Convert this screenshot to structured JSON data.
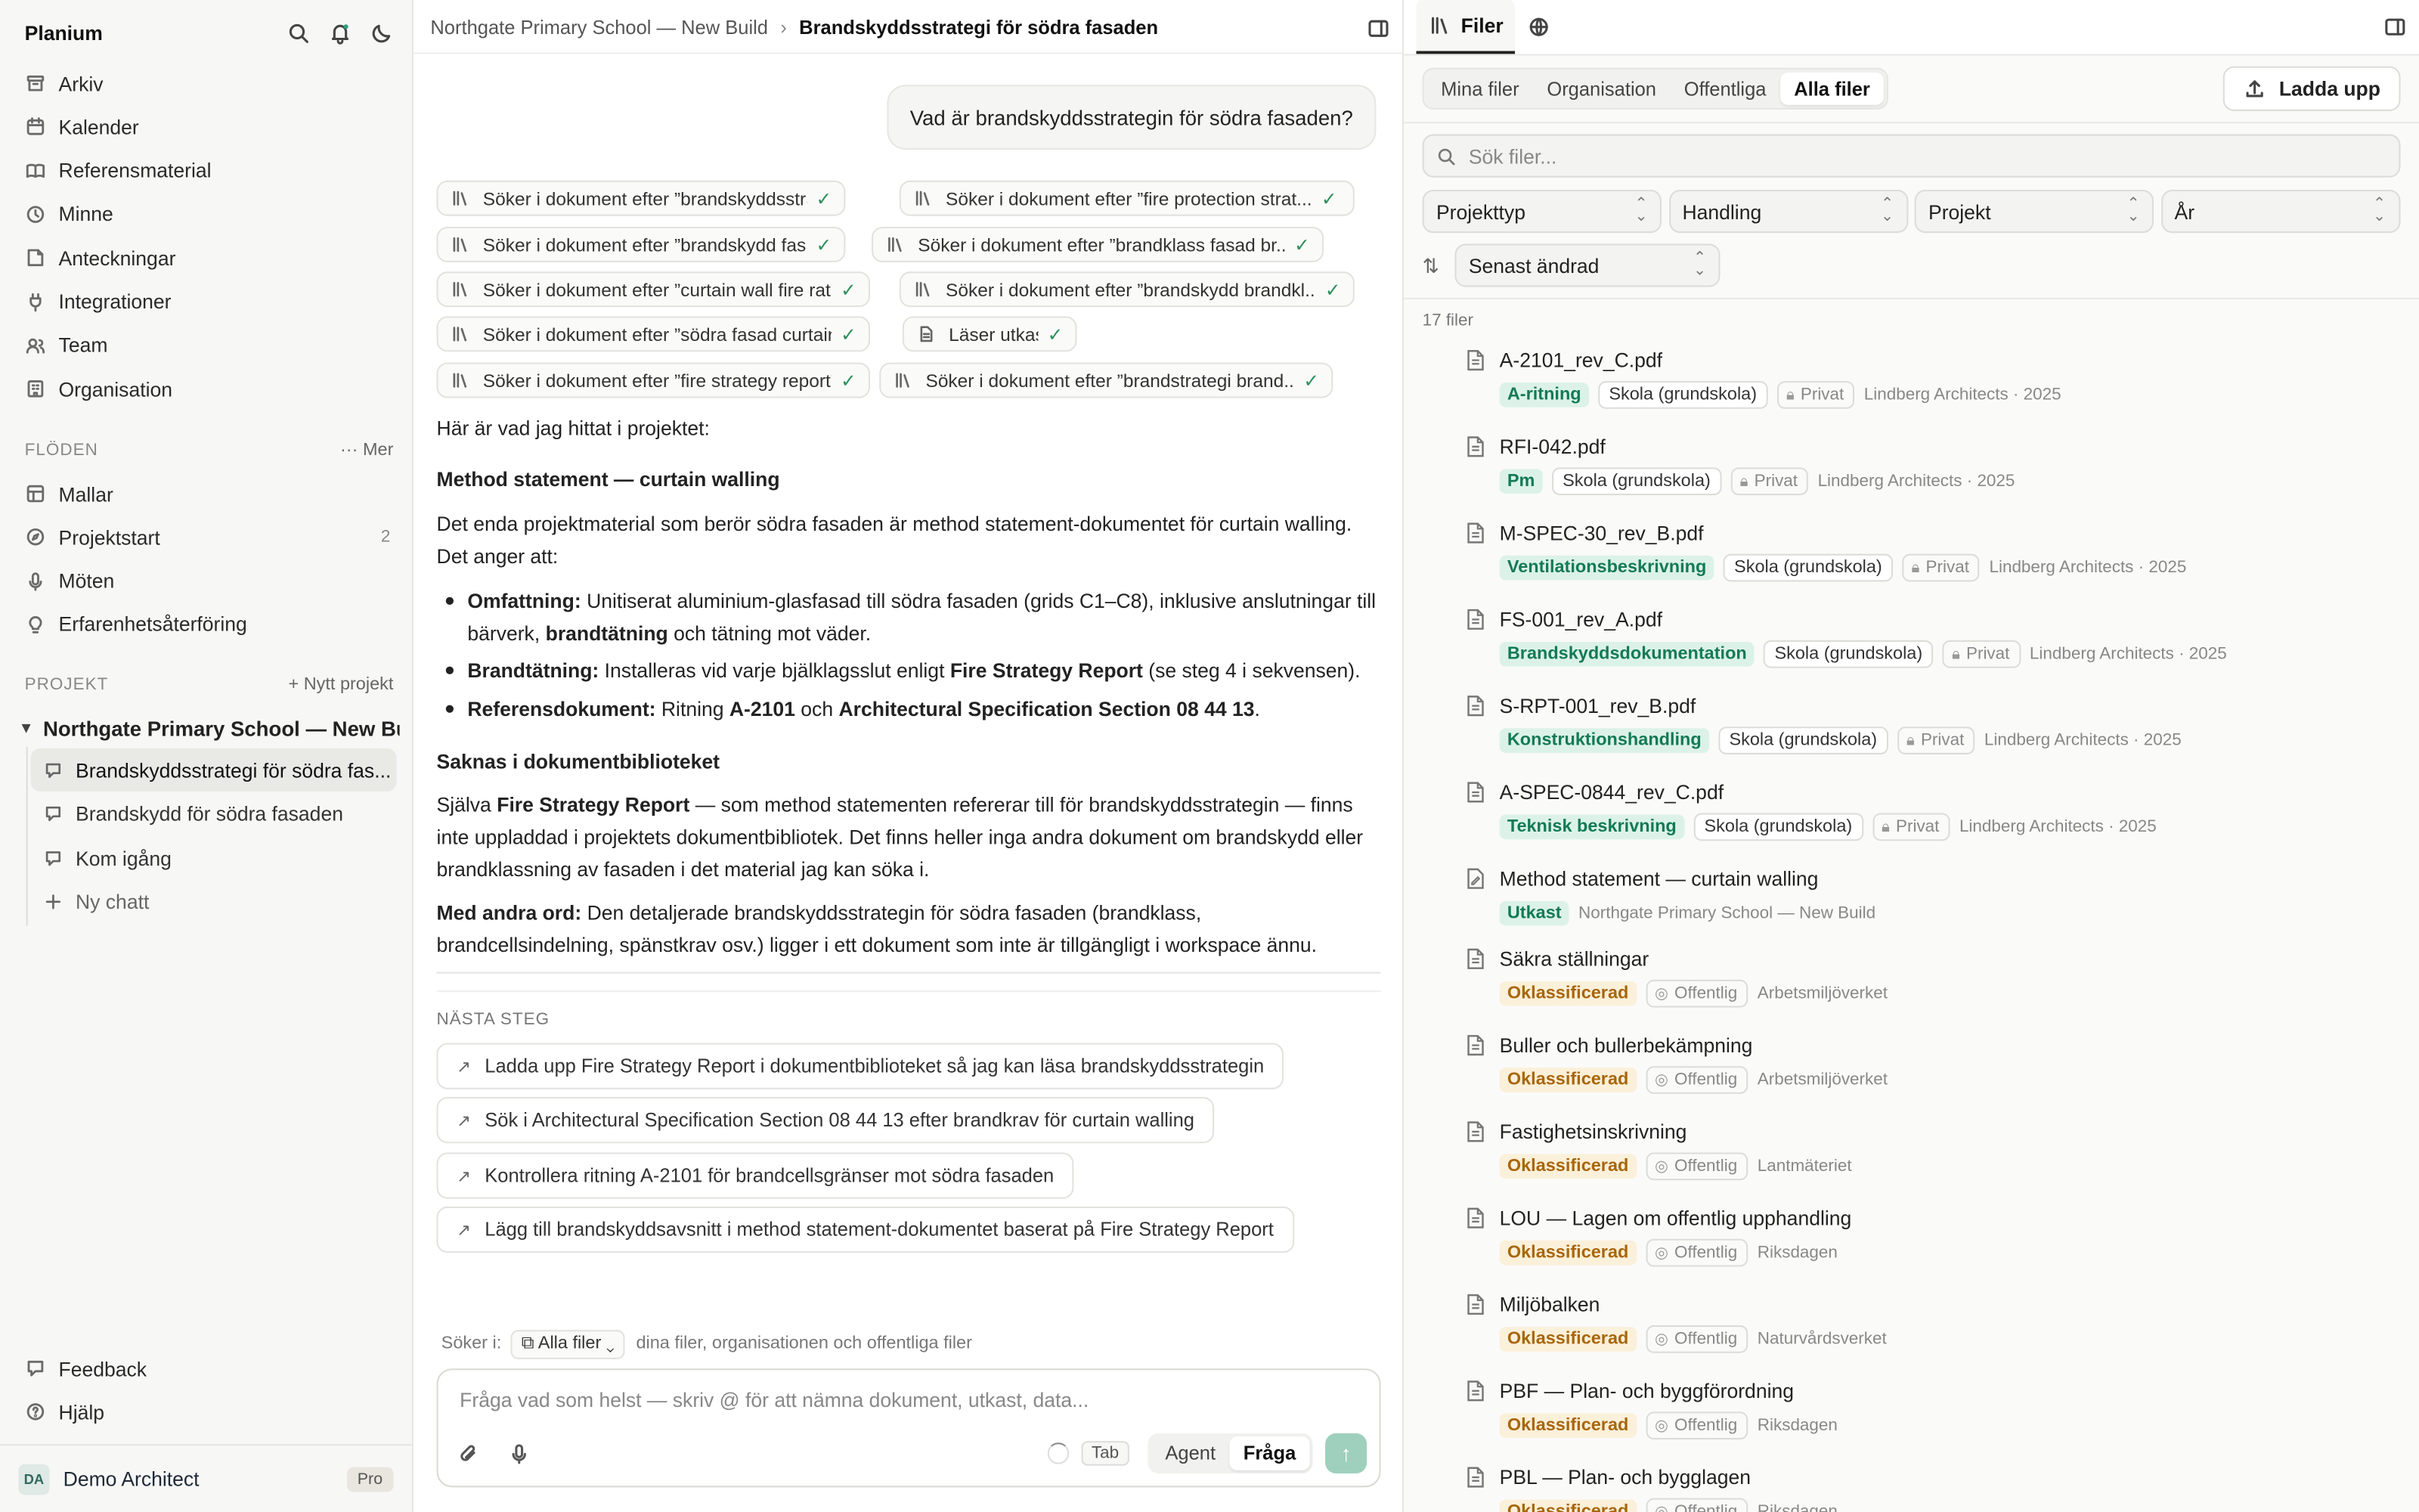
{
  "sidebar": {
    "brand": "Planium",
    "nav": [
      {
        "label": "Arkiv",
        "icon": "archive-icon"
      },
      {
        "label": "Kalender",
        "icon": "calendar-icon"
      },
      {
        "label": "Referensmaterial",
        "icon": "book-icon"
      },
      {
        "label": "Minne",
        "icon": "memory-icon"
      },
      {
        "label": "Anteckningar",
        "icon": "note-icon"
      },
      {
        "label": "Integrationer",
        "icon": "plug-icon"
      },
      {
        "label": "Team",
        "icon": "users-icon"
      },
      {
        "label": "Organisation",
        "icon": "building-icon"
      }
    ],
    "flows_label": "FLÖDEN",
    "flows_more": "··· Mer",
    "flows": [
      {
        "label": "Mallar",
        "icon": "template-icon",
        "count": ""
      },
      {
        "label": "Projektstart",
        "icon": "compass-icon",
        "count": "2"
      },
      {
        "label": "Möten",
        "icon": "mic-icon",
        "count": ""
      },
      {
        "label": "Erfarenhetsåterföring",
        "icon": "lightbulb-icon",
        "count": ""
      }
    ],
    "projects_label": "PROJEKT",
    "new_project": "+ Nytt projekt",
    "project_name": "Northgate Primary School — New Bu...",
    "chats": [
      {
        "label": "Brandskyddsstrategi för södra fas...",
        "active": true
      },
      {
        "label": "Brandskydd för södra fasaden",
        "active": false
      },
      {
        "label": "Kom igång",
        "active": false
      }
    ],
    "new_chat": "Ny chatt",
    "feedback": "Feedback",
    "help": "Hjälp",
    "user_initials": "DA",
    "user_name": "Demo Architect",
    "plan": "Pro"
  },
  "chat": {
    "breadcrumb_project": "Northgate Primary School — New Build",
    "breadcrumb_current": "Brandskyddsstrategi för södra fasaden",
    "user_message": "Vad är brandskyddsstrategin för södra fasaden?",
    "tools": [
      "Söker i dokument efter ”brandskyddsstrategi...",
      "Söker i dokument efter ”fire protection strat...",
      "Söker i dokument efter ”brandskydd fasad”",
      "Söker i dokument efter ”brandklass fasad br...",
      "Söker i dokument efter ”curtain wall fire rati...",
      "Söker i dokument efter ”brandskydd brandkl...",
      "Söker i dokument efter ”södra fasad curtain ...",
      "Läser utkast",
      "Söker i dokument efter ”fire strategy report”",
      "Söker i dokument efter ”brandstrategi brand..."
    ],
    "intro": "Här är vad jag hittat i projektet:",
    "h1": "Method statement — curtain walling",
    "p1": "Det enda projektmaterial som berör södra fasaden är method statement-dokumentet för curtain walling. Det anger att:",
    "b1_label": "Omfattning:",
    "b1_text_a": "Unitiserat aluminium-glasfasad till södra fasaden (grids C1–C8), inklusive anslutningar till bärverk,",
    "b1_bold": "brandtätning",
    "b1_text_b": "och tätning mot väder.",
    "b2_label": "Brandtätning:",
    "b2_text_a": "Installeras vid varje bjälklagsslut enligt",
    "b2_bold": "Fire Strategy Report",
    "b2_text_b": "(se steg 4 i sekvensen).",
    "b3_label": "Referensdokument:",
    "b3_text_a": "Ritning",
    "b3_bold1": "A-2101",
    "b3_text_b": "och",
    "b3_bold2": "Architectural Specification Section 08 44 13",
    "b3_text_c": ".",
    "h2": "Saknas i dokumentbiblioteket",
    "p2_a": "Själva",
    "p2_bold": "Fire Strategy Report",
    "p2_b": "— som method statementen refererar till för brandskyddsstrategin — finns inte uppladdad i projektets dokumentbibliotek. Det finns heller inga andra dokument om brandskydd eller brandklassning av fasaden i det material jag kan söka i.",
    "p3_bold": "Med andra ord:",
    "p3": "Den detaljerade brandskyddsstrategin för södra fasaden (brandklass, brandcellsindelning, spänstkrav osv.) ligger i ett dokument som inte är tillgängligt i workspace ännu.",
    "next_label": "NÄSTA STEG",
    "next": [
      "Ladda upp Fire Strategy Report i dokumentbiblioteket så jag kan läsa brandskyddsstrategin",
      "Sök i Architectural Specification Section 08 44 13 efter brandkrav för curtain walling",
      "Kontrollera ritning A-2101 för brandcellsgränser mot södra fasaden",
      "Lägg till brandskyddsavsnitt i method statement-dokumentet baserat på Fire Strategy Report"
    ],
    "search_in_label": "Söker i:",
    "scope": "Alla filer",
    "scope_desc": "dina filer, organisationen och offentliga filer",
    "input_placeholder": "Fråga vad som helst — skriv @ för att nämna dokument, utkast, data...",
    "tab_hint": "Tab",
    "mode_agent": "Agent",
    "mode_ask": "Fråga"
  },
  "files": {
    "tab_files": "Filer",
    "segments": [
      "Mina filer",
      "Organisation",
      "Offentliga",
      "Alla filer"
    ],
    "active_segment": "Alla filer",
    "upload": "Ladda upp",
    "search_placeholder": "Sök filer...",
    "filters": [
      "Projekttyp",
      "Handling",
      "Projekt",
      "År"
    ],
    "sort": "Senast ändrad",
    "count": "17 filer",
    "items": [
      {
        "name": "A-2101_rev_C.pdf",
        "tag": "A-ritning",
        "tag_color": "green",
        "chip": "Skola (grundskola)",
        "vis": "Privat",
        "src": "Lindberg Architects · 2025"
      },
      {
        "name": "RFI-042.pdf",
        "tag": "Pm",
        "tag_color": "green",
        "chip": "Skola (grundskola)",
        "vis": "Privat",
        "src": "Lindberg Architects · 2025"
      },
      {
        "name": "M-SPEC-30_rev_B.pdf",
        "tag": "Ventilationsbeskrivning",
        "tag_color": "green",
        "chip": "Skola (grundskola)",
        "vis": "Privat",
        "src": "Lindberg Architects · 2025"
      },
      {
        "name": "FS-001_rev_A.pdf",
        "tag": "Brandskyddsdokumentation",
        "tag_color": "green",
        "chip": "Skola (grundskola)",
        "vis": "Privat",
        "src": "Lindberg Architects · 2025"
      },
      {
        "name": "S-RPT-001_rev_B.pdf",
        "tag": "Konstruktionshandling",
        "tag_color": "green",
        "chip": "Skola (grundskola)",
        "vis": "Privat",
        "src": "Lindberg Architects · 2025"
      },
      {
        "name": "A-SPEC-0844_rev_C.pdf",
        "tag": "Teknisk beskrivning",
        "tag_color": "green",
        "chip": "Skola (grundskola)",
        "vis": "Privat",
        "src": "Lindberg Architects · 2025"
      },
      {
        "name": "Method statement — curtain walling",
        "tag": "Utkast",
        "tag_color": "green",
        "chip": "",
        "vis": "",
        "src": "Northgate Primary School — New Build"
      },
      {
        "name": "Säkra ställningar",
        "tag": "Oklassificerad",
        "tag_color": "amber",
        "chip": "",
        "vis": "Offentlig",
        "src": "Arbetsmiljöverket"
      },
      {
        "name": "Buller och bullerbekämpning",
        "tag": "Oklassificerad",
        "tag_color": "amber",
        "chip": "",
        "vis": "Offentlig",
        "src": "Arbetsmiljöverket"
      },
      {
        "name": "Fastighetsinskrivning",
        "tag": "Oklassificerad",
        "tag_color": "amber",
        "chip": "",
        "vis": "Offentlig",
        "src": "Lantmäteriet"
      },
      {
        "name": "LOU — Lagen om offentlig upphandling",
        "tag": "Oklassificerad",
        "tag_color": "amber",
        "chip": "",
        "vis": "Offentlig",
        "src": "Riksdagen"
      },
      {
        "name": "Miljöbalken",
        "tag": "Oklassificerad",
        "tag_color": "amber",
        "chip": "",
        "vis": "Offentlig",
        "src": "Naturvårdsverket"
      },
      {
        "name": "PBF — Plan- och byggförordning",
        "tag": "Oklassificerad",
        "tag_color": "amber",
        "chip": "",
        "vis": "Offentlig",
        "src": "Riksdagen"
      },
      {
        "name": "PBL — Plan- och bygglagen",
        "tag": "Oklassificerad",
        "tag_color": "amber",
        "chip": "",
        "vis": "Offentlig",
        "src": "Riksdagen"
      }
    ]
  }
}
